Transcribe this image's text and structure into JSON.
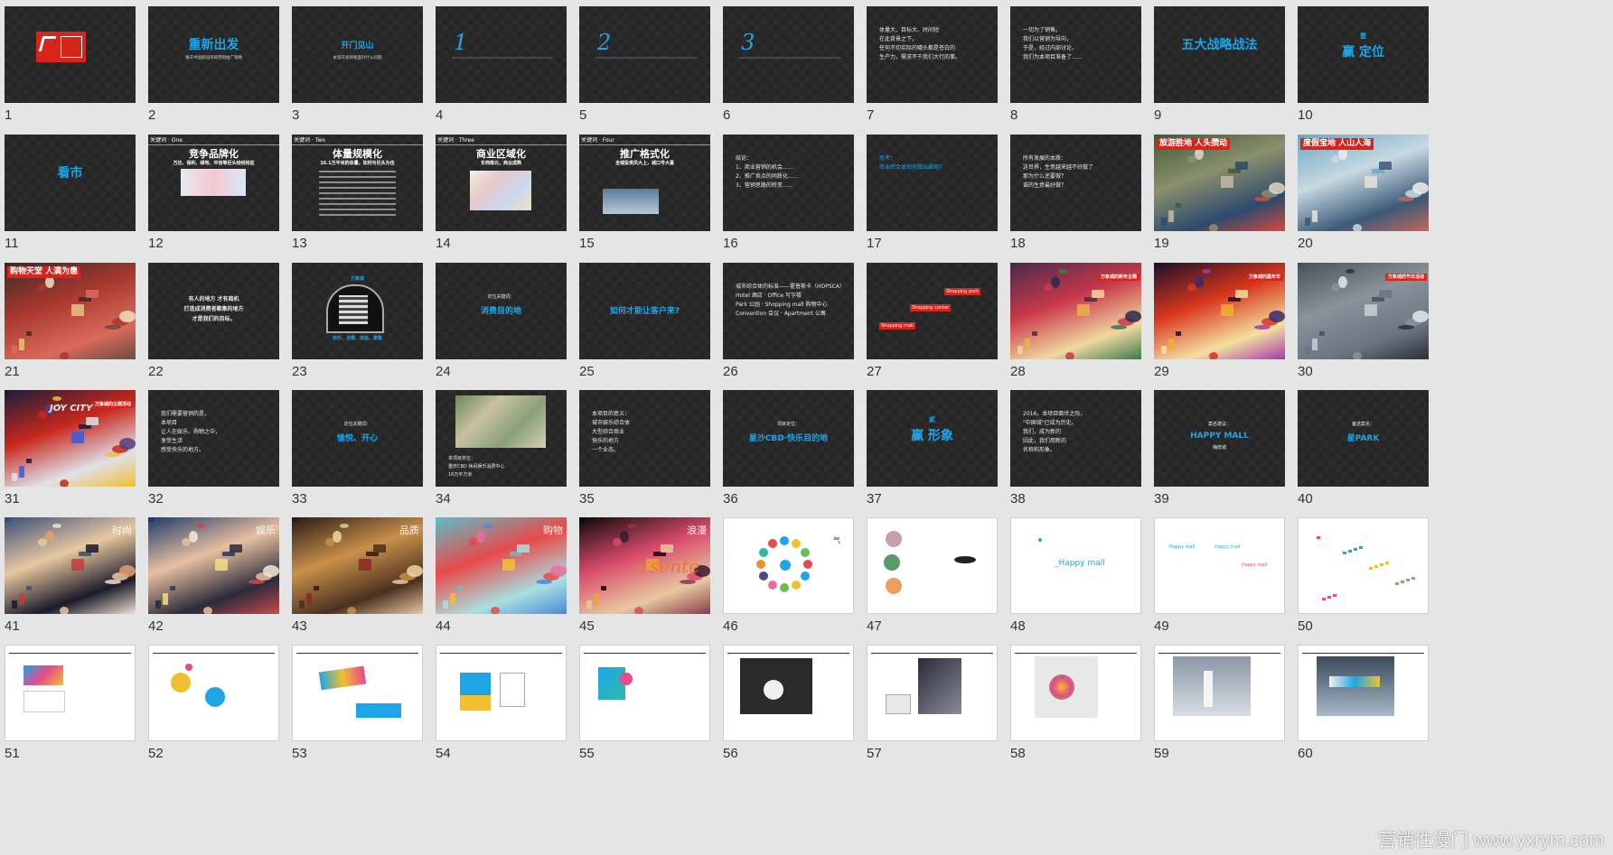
{
  "slides": [
    {
      "n": "1",
      "kind": "logo"
    },
    {
      "n": "2",
      "kind": "title",
      "title": "重新出发",
      "sub": "重庆中国新园项目营销推广策略"
    },
    {
      "n": "3",
      "kind": "title-small",
      "title": "开门见山",
      "sub": "本案开发将要面对什么问题"
    },
    {
      "n": "4",
      "kind": "number",
      "big": "1"
    },
    {
      "n": "5",
      "kind": "number",
      "big": "2"
    },
    {
      "n": "6",
      "kind": "number",
      "big": "3"
    },
    {
      "n": "7",
      "kind": "text",
      "lines": [
        "体量大、目标大、时间短",
        "在此背景之下，",
        "任何不切实际的噱头都是苍白的",
        "生产力，需求不干我们大行的事。"
      ]
    },
    {
      "n": "8",
      "kind": "text",
      "lines": [
        "一切为了销售。",
        "我们以营销为导向，",
        "于是，经过内部讨论，",
        "我们为本项目准备了……"
      ]
    },
    {
      "n": "9",
      "kind": "title",
      "title": "五大战略战法"
    },
    {
      "n": "10",
      "kind": "title",
      "pre": "壹",
      "title": "赢 定位"
    },
    {
      "n": "11",
      "kind": "title",
      "title": "看市"
    },
    {
      "n": "12",
      "kind": "keyword",
      "tag": "关键词 · One",
      "title": "竞争品牌化",
      "sub": "万达、保利、绿地、中信等巨头纷纷抢驻"
    },
    {
      "n": "13",
      "kind": "keyword-table",
      "tag": "关键词 · Two",
      "title": "体量规模化",
      "sub": "16.1万平米的体量，如何与巨头为伍"
    },
    {
      "n": "14",
      "kind": "keyword-map",
      "tag": "关键词 · Three",
      "title": "商业区域化",
      "sub": "东西南北，商业成熟"
    },
    {
      "n": "15",
      "kind": "keyword-img",
      "tag": "关键词 · Four",
      "title": "推广格式化",
      "sub": "全城投资风大上，城口号大喜"
    },
    {
      "n": "16",
      "kind": "text",
      "lines": [
        "结论：",
        "1、商业营销的机会……",
        "2、推广卖点的同质化……",
        "3、营销思路的转变……"
      ]
    },
    {
      "n": "17",
      "kind": "text-blue",
      "lines": [
        "思考：",
        "商业综合体如何做出破局？"
      ]
    },
    {
      "n": "18",
      "kind": "text",
      "lines": [
        "所有发展的本质：",
        "这世界，生意越来越不好做了",
        "那为什么还要做？",
        "谁的生意最好做？"
      ]
    },
    {
      "n": "19",
      "kind": "photo",
      "tag": "旅游胜地 人头攒动",
      "palette": "crowd-green"
    },
    {
      "n": "20",
      "kind": "photo",
      "tag": "度假宝地 人山人海",
      "palette": "crowd-water"
    },
    {
      "n": "21",
      "kind": "photo",
      "tag": "购物天堂 人满为患",
      "palette": "street"
    },
    {
      "n": "22",
      "kind": "text-center",
      "lines": [
        "有人的地方 才有商机",
        "打造成消费者聚集的地方",
        "才是我们的目标。"
      ]
    },
    {
      "n": "23",
      "kind": "tunnel",
      "top": "万象城",
      "bottom": "快乐、消费、体验、聚集"
    },
    {
      "n": "24",
      "kind": "blue-center",
      "pre": "定位关键词：",
      "title": "消费目的地"
    },
    {
      "n": "25",
      "kind": "blue-center",
      "title": "如何才能让客户来?"
    },
    {
      "n": "26",
      "kind": "text",
      "lines": [
        "城市综合体的标准——霍普斯卡（HOPSCA）",
        "Hotel 酒店 · Office 写字楼",
        "Park 公园 · Shopping mall 购物中心",
        "Convention 会议 · Apartment 公寓"
      ]
    },
    {
      "n": "27",
      "kind": "shopping",
      "a": "Shopping park",
      "b": "Shopping center",
      "c": "Shopping mall"
    },
    {
      "n": "28",
      "kind": "photo",
      "tag": "万象城的新年主题",
      "palette": "festival"
    },
    {
      "n": "29",
      "kind": "photo",
      "tag": "万象城的嘉年华",
      "palette": "stage"
    },
    {
      "n": "30",
      "kind": "photo",
      "tag": "万象城的节日活动",
      "palette": "plaza"
    },
    {
      "n": "31",
      "kind": "photo",
      "tag": "万象城的主题活动",
      "palette": "joycity",
      "brand": "JOY CITY"
    },
    {
      "n": "32",
      "kind": "text",
      "lines": [
        "我们需要营销的是，",
        "本项目",
        "让人在娱乐、购物之中，",
        "享受生活",
        "感受快乐的地方。"
      ]
    },
    {
      "n": "33",
      "kind": "blue-center",
      "pre": "定位关键词：",
      "title": "愉悦、开心"
    },
    {
      "n": "34",
      "kind": "aerial",
      "lines": [
        "本项目定位：",
        "重庆CBD 休闲娱乐消费中心",
        "16万平方米"
      ]
    },
    {
      "n": "35",
      "kind": "text",
      "lines": [
        "本项目的意义：",
        "城市娱乐综合体",
        "大型综合商业",
        "快乐的地方",
        "一个业态。"
      ]
    },
    {
      "n": "36",
      "kind": "blue-center",
      "pre": "项目定位：",
      "title": "星沙CBD·快乐目的地"
    },
    {
      "n": "37",
      "kind": "title",
      "pre": "贰",
      "title": "赢 形象"
    },
    {
      "n": "38",
      "kind": "text",
      "lines": [
        "2016，本项目面世之际，",
        "\"中国城\"已成为历史。",
        "我们，成为新的",
        "因此，我们用新的",
        "名称和形象。"
      ]
    },
    {
      "n": "39",
      "kind": "blue-center",
      "pre": "案名建议：",
      "title": "HAPPY MALL",
      "sub": "嗨皮城"
    },
    {
      "n": "40",
      "kind": "blue-center",
      "pre": "备选案名：",
      "title": "星PARK"
    },
    {
      "n": "41",
      "kind": "photo-cn",
      "label": "时尚",
      "palette": "glasses"
    },
    {
      "n": "42",
      "kind": "photo-cn",
      "label": "娱乐",
      "palette": "party"
    },
    {
      "n": "43",
      "kind": "photo-cn",
      "label": "品质",
      "palette": "wine"
    },
    {
      "n": "44",
      "kind": "photo-cn",
      "label": "购物",
      "palette": "shoes"
    },
    {
      "n": "45",
      "kind": "photo-cn",
      "label": "浪漫",
      "palette": "carousel",
      "script": "a sente"
    },
    {
      "n": "46",
      "kind": "dots",
      "label": "气"
    },
    {
      "n": "47",
      "kind": "white-misc"
    },
    {
      "n": "48",
      "kind": "white-logo",
      "title": "_Happy mall"
    },
    {
      "n": "49",
      "kind": "white-logos",
      "a": "Happy mall",
      "b": "Happy mall",
      "c": "Happy mall"
    },
    {
      "n": "50",
      "kind": "white-scatter"
    },
    {
      "n": "51",
      "kind": "vi",
      "variant": "card"
    },
    {
      "n": "52",
      "kind": "vi",
      "variant": "circles"
    },
    {
      "n": "53",
      "kind": "vi",
      "variant": "envelope"
    },
    {
      "n": "54",
      "kind": "vi",
      "variant": "bag"
    },
    {
      "n": "55",
      "kind": "vi",
      "variant": "card2"
    },
    {
      "n": "56",
      "kind": "vi",
      "variant": "tableware"
    },
    {
      "n": "57",
      "kind": "vi",
      "variant": "perfume"
    },
    {
      "n": "58",
      "kind": "vi",
      "variant": "shirt"
    },
    {
      "n": "59",
      "kind": "vi",
      "variant": "kiosk"
    },
    {
      "n": "60",
      "kind": "vi",
      "variant": "sign"
    }
  ],
  "watermark": "营销性漫门 www.yxrym.com",
  "colors": {
    "accent": "#1ea5e8",
    "red": "#d8251c",
    "panel": "#2b2b2b",
    "bg": "#e5e5e5"
  }
}
